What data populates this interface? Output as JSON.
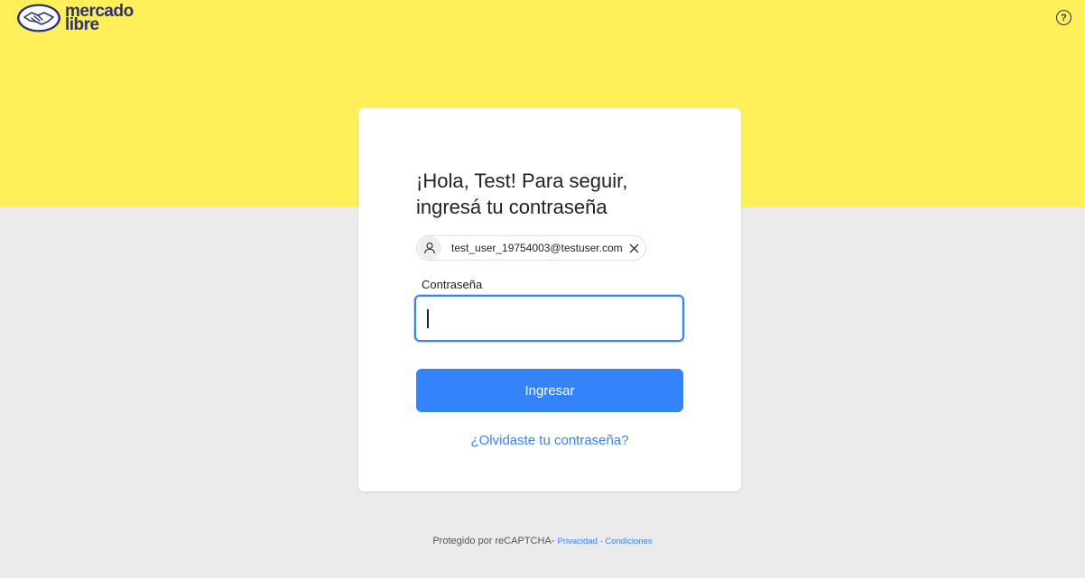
{
  "header": {
    "logo_line1": "mercado",
    "logo_line2": "libre",
    "help_icon": "question-circle-icon",
    "help_glyph": "?"
  },
  "login": {
    "title_line1": "¡Hola, Test! Para seguir,",
    "title_line2": "ingresá tu contraseña",
    "user_email": "test_user_19754003@testuser.com",
    "password_label": "Contraseña",
    "password_value": "",
    "submit_label": "Ingresar",
    "forgot_label": "¿Olvidaste tu contraseña?"
  },
  "footer": {
    "protected_text": "Protegido por reCAPTCHA",
    "separator1": "- ",
    "privacy_label": "Privacidad",
    "separator2": " - ",
    "terms_label": "Condiciones"
  },
  "colors": {
    "brand_yellow": "#fff059",
    "brand_blue": "#2d3277",
    "accent_blue": "#3483fa",
    "background": "#ebebeb"
  }
}
